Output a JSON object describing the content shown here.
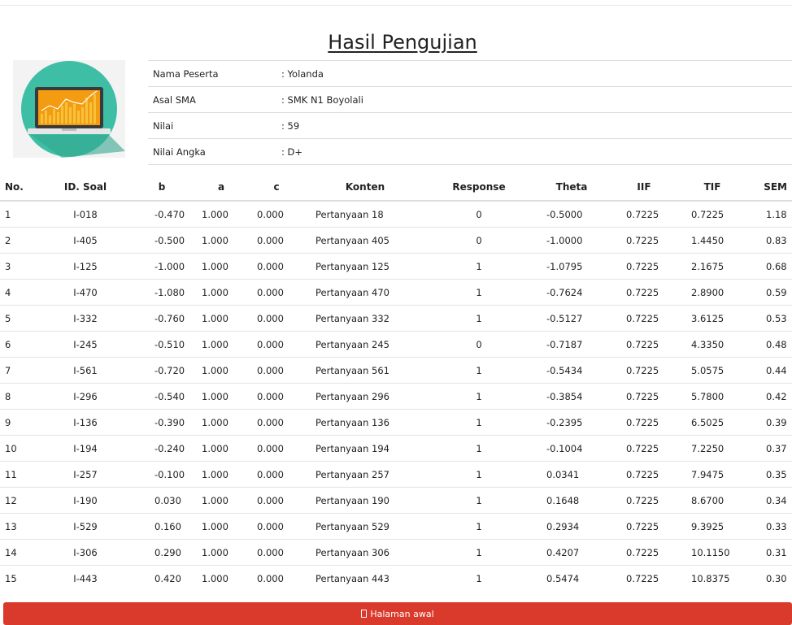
{
  "page": {
    "title": "Hasil Pengujian"
  },
  "participant": [
    {
      "label": "Nama Peserta",
      "value": ": Yolanda"
    },
    {
      "label": "Asal SMA",
      "value": ": SMK N1 Boyolali"
    },
    {
      "label": "Nilai",
      "value": ": 59"
    },
    {
      "label": "Nilai Angka",
      "value": ": D+"
    }
  ],
  "table": {
    "headers": [
      "No.",
      "ID. Soal",
      "b",
      "a",
      "c",
      "Konten",
      "Response",
      "Theta",
      "IIF",
      "TIF",
      "SEM"
    ],
    "rows": [
      [
        "1",
        "I-018",
        "-0.470",
        "1.000",
        "0.000",
        "Pertanyaan 18",
        "0",
        "-0.5000",
        "0.7225",
        "0.7225",
        "1.18"
      ],
      [
        "2",
        "I-405",
        "-0.500",
        "1.000",
        "0.000",
        "Pertanyaan 405",
        "0",
        "-1.0000",
        "0.7225",
        "1.4450",
        "0.83"
      ],
      [
        "3",
        "I-125",
        "-1.000",
        "1.000",
        "0.000",
        "Pertanyaan 125",
        "1",
        "-1.0795",
        "0.7225",
        "2.1675",
        "0.68"
      ],
      [
        "4",
        "I-470",
        "-1.080",
        "1.000",
        "0.000",
        "Pertanyaan 470",
        "1",
        "-0.7624",
        "0.7225",
        "2.8900",
        "0.59"
      ],
      [
        "5",
        "I-332",
        "-0.760",
        "1.000",
        "0.000",
        "Pertanyaan 332",
        "1",
        "-0.5127",
        "0.7225",
        "3.6125",
        "0.53"
      ],
      [
        "6",
        "I-245",
        "-0.510",
        "1.000",
        "0.000",
        "Pertanyaan 245",
        "0",
        "-0.7187",
        "0.7225",
        "4.3350",
        "0.48"
      ],
      [
        "7",
        "I-561",
        "-0.720",
        "1.000",
        "0.000",
        "Pertanyaan 561",
        "1",
        "-0.5434",
        "0.7225",
        "5.0575",
        "0.44"
      ],
      [
        "8",
        "I-296",
        "-0.540",
        "1.000",
        "0.000",
        "Pertanyaan 296",
        "1",
        "-0.3854",
        "0.7225",
        "5.7800",
        "0.42"
      ],
      [
        "9",
        "I-136",
        "-0.390",
        "1.000",
        "0.000",
        "Pertanyaan 136",
        "1",
        "-0.2395",
        "0.7225",
        "6.5025",
        "0.39"
      ],
      [
        "10",
        "I-194",
        "-0.240",
        "1.000",
        "0.000",
        "Pertanyaan 194",
        "1",
        "-0.1004",
        "0.7225",
        "7.2250",
        "0.37"
      ],
      [
        "11",
        "I-257",
        "-0.100",
        "1.000",
        "0.000",
        "Pertanyaan 257",
        "1",
        "0.0341",
        "0.7225",
        "7.9475",
        "0.35"
      ],
      [
        "12",
        "I-190",
        "0.030",
        "1.000",
        "0.000",
        "Pertanyaan 190",
        "1",
        "0.1648",
        "0.7225",
        "8.6700",
        "0.34"
      ],
      [
        "13",
        "I-529",
        "0.160",
        "1.000",
        "0.000",
        "Pertanyaan 529",
        "1",
        "0.2934",
        "0.7225",
        "9.3925",
        "0.33"
      ],
      [
        "14",
        "I-306",
        "0.290",
        "1.000",
        "0.000",
        "Pertanyaan 306",
        "1",
        "0.4207",
        "0.7225",
        "10.1150",
        "0.31"
      ],
      [
        "15",
        "I-443",
        "0.420",
        "1.000",
        "0.000",
        "Pertanyaan 443",
        "1",
        "0.5474",
        "0.7225",
        "10.8375",
        "0.30"
      ]
    ]
  },
  "footer": {
    "button_label": "Halaman awal",
    "button_icon": "home-icon",
    "button_color": "#d93a2c"
  },
  "logo": {
    "icon": "laptop-chart-icon",
    "circle_color": "#3ebfa5",
    "bar_color": "#f4a623"
  }
}
